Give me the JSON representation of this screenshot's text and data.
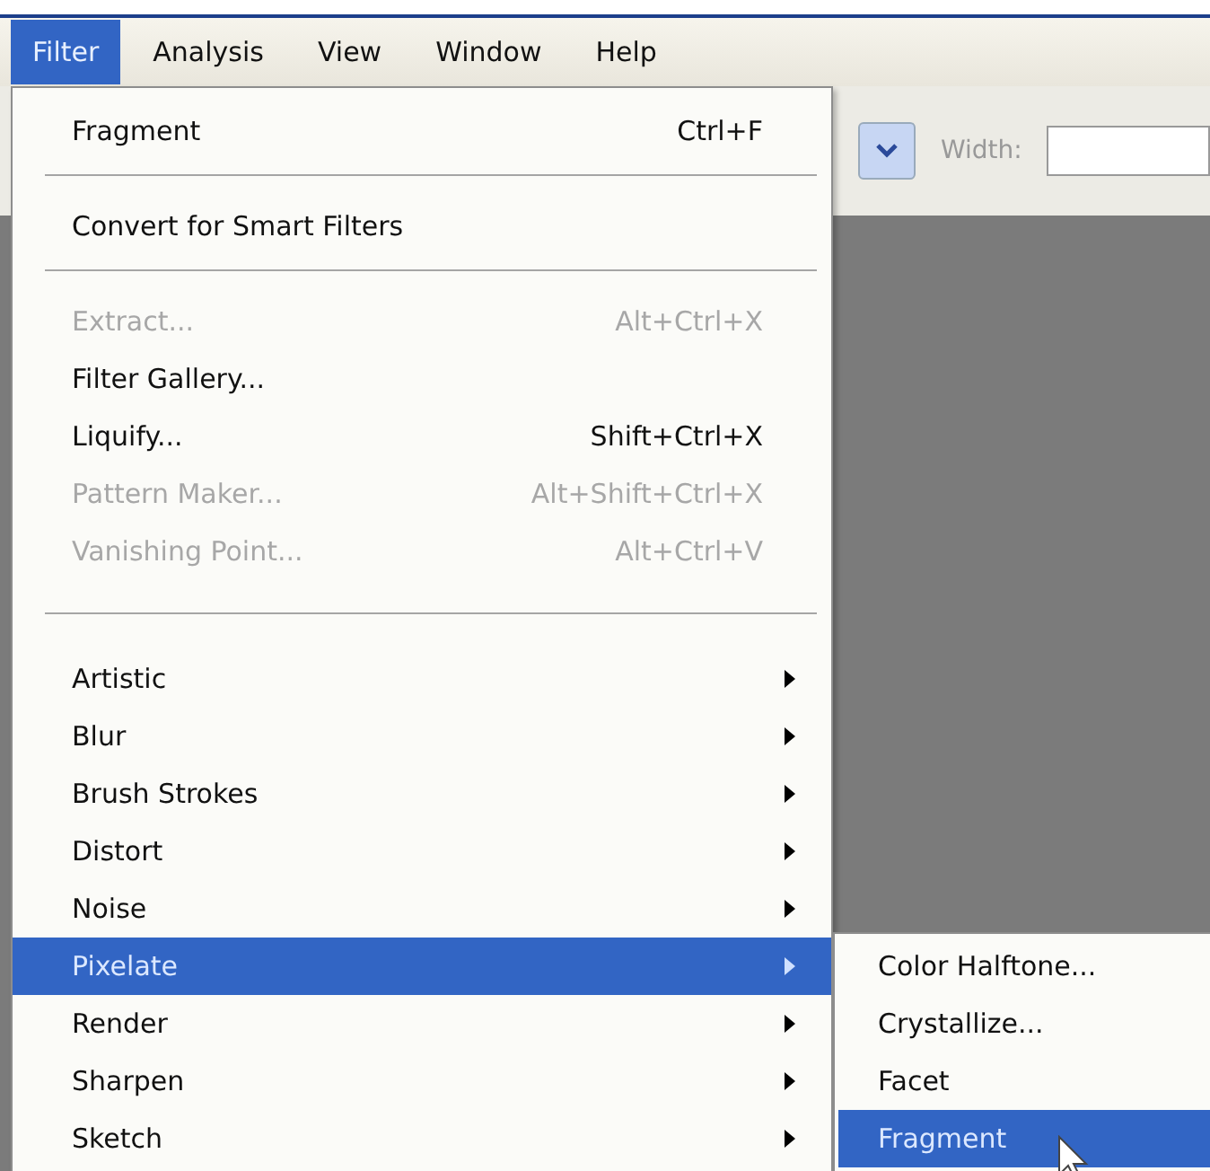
{
  "menubar": [
    {
      "label": "Filter",
      "selected": true
    },
    {
      "label": "Analysis",
      "selected": false
    },
    {
      "label": "View",
      "selected": false
    },
    {
      "label": "Window",
      "selected": false
    },
    {
      "label": "Help",
      "selected": false
    }
  ],
  "toolbar": {
    "width_label": "Width:"
  },
  "menu": {
    "sections": [
      [
        {
          "label": "Fragment",
          "shortcut": "Ctrl+F",
          "disabled": false,
          "submenu": false,
          "selected": false
        }
      ],
      [
        {
          "label": "Convert for Smart Filters",
          "disabled": false,
          "submenu": false,
          "selected": false
        }
      ],
      [
        {
          "label": "Extract...",
          "shortcut": "Alt+Ctrl+X",
          "disabled": true,
          "submenu": false,
          "selected": false
        },
        {
          "label": "Filter Gallery...",
          "disabled": false,
          "submenu": false,
          "selected": false
        },
        {
          "label": "Liquify...",
          "shortcut": "Shift+Ctrl+X",
          "disabled": false,
          "submenu": false,
          "selected": false
        },
        {
          "label": "Pattern Maker...",
          "shortcut": "Alt+Shift+Ctrl+X",
          "disabled": true,
          "submenu": false,
          "selected": false
        },
        {
          "label": "Vanishing Point...",
          "shortcut": "Alt+Ctrl+V",
          "disabled": true,
          "submenu": false,
          "selected": false
        }
      ],
      [
        {
          "label": "Artistic",
          "disabled": false,
          "submenu": true,
          "selected": false
        },
        {
          "label": "Blur",
          "disabled": false,
          "submenu": true,
          "selected": false
        },
        {
          "label": "Brush Strokes",
          "disabled": false,
          "submenu": true,
          "selected": false
        },
        {
          "label": "Distort",
          "disabled": false,
          "submenu": true,
          "selected": false
        },
        {
          "label": "Noise",
          "disabled": false,
          "submenu": true,
          "selected": false
        },
        {
          "label": "Pixelate",
          "disabled": false,
          "submenu": true,
          "selected": true
        },
        {
          "label": "Render",
          "disabled": false,
          "submenu": true,
          "selected": false
        },
        {
          "label": "Sharpen",
          "disabled": false,
          "submenu": true,
          "selected": false
        },
        {
          "label": "Sketch",
          "disabled": false,
          "submenu": true,
          "selected": false
        }
      ]
    ]
  },
  "submenu": {
    "items": [
      {
        "label": "Color Halftone...",
        "selected": false
      },
      {
        "label": "Crystallize...",
        "selected": false
      },
      {
        "label": "Facet",
        "selected": false
      },
      {
        "label": "Fragment",
        "selected": true
      }
    ]
  }
}
